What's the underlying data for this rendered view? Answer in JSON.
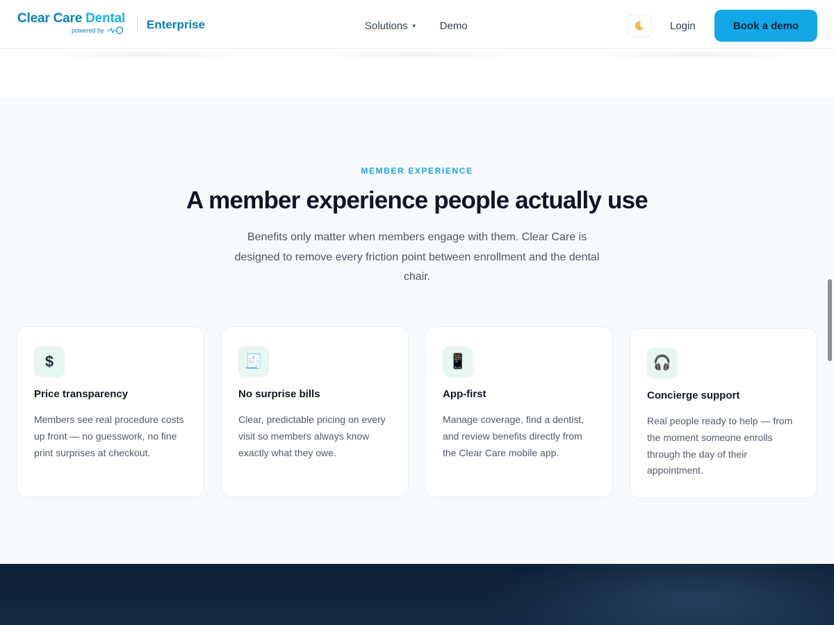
{
  "header": {
    "logo_main": "Clear Care",
    "logo_accent": "Dental",
    "logo_sub": "powered by",
    "product": "Enterprise",
    "nav": [
      {
        "label": "Solutions",
        "has_dropdown": true
      },
      {
        "label": "Demo"
      }
    ],
    "theme_toggle_icon": "moon-icon",
    "login": "Login",
    "cta": "Book a demo"
  },
  "member": {
    "eyebrow": "MEMBER EXPERIENCE",
    "headline": "A member experience people actually use",
    "lede": "Benefits only matter when members engage with them. Clear Care is designed to remove every friction point between enrollment and the dental chair.",
    "cards": [
      {
        "icon": "dollar-icon",
        "glyph": "$",
        "title": "Price transparency",
        "body": "Members see real procedure costs up front — no guesswork, no fine print surprises at checkout."
      },
      {
        "icon": "receipt-icon",
        "glyph": "🧾",
        "title": "No surprise bills",
        "body": "Clear, predictable pricing on every visit so members always know exactly what they owe."
      },
      {
        "icon": "mobile-phone-icon",
        "glyph": "📱",
        "title": "App-first",
        "body": "Manage coverage, find a dentist, and review benefits directly from the Clear Care mobile app."
      },
      {
        "icon": "headphones-icon",
        "glyph": "🎧",
        "title": "Concierge support",
        "body": "Real people ready to help — from the moment someone enrolls through the day of their appointment."
      }
    ]
  },
  "colors": {
    "brand": "#0b7fb8",
    "accent": "#13a7e8",
    "section_bg": "#f6fafd",
    "icon_bg": "#e6f6f1",
    "dark_band": "#0d1f35"
  }
}
